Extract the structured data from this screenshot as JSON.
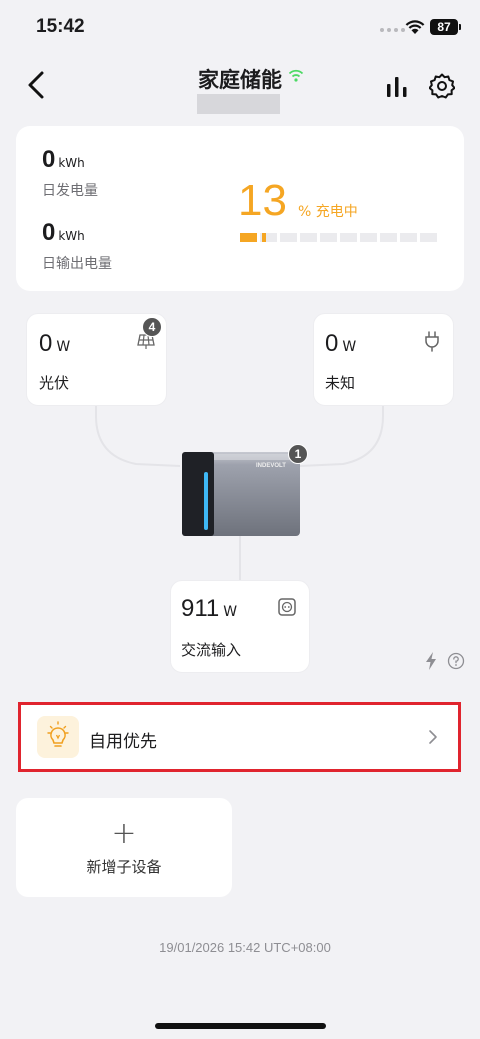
{
  "status": {
    "time": "15:42",
    "battery": "87"
  },
  "nav": {
    "title": "家庭储能"
  },
  "summary": {
    "daily_gen_value": "0",
    "daily_gen_unit": "kWh",
    "daily_gen_label": "日发电量",
    "daily_out_value": "0",
    "daily_out_unit": "kWh",
    "daily_out_label": "日输出电量",
    "soc_value": "13",
    "soc_unit": "%",
    "soc_status": "充电中",
    "soc_fraction": 0.13,
    "accent": "#f5a623"
  },
  "flow": {
    "pv": {
      "value": "0",
      "unit": "W",
      "label": "光伏",
      "badge": "4",
      "icon": "solar-panel-icon"
    },
    "unknown": {
      "value": "0",
      "unit": "W",
      "label": "未知",
      "icon": "plug-icon"
    },
    "battery": {
      "badge": "1",
      "brand": "INDEVOLT"
    },
    "ac": {
      "value": "911",
      "unit": "W",
      "label": "交流输入",
      "icon": "socket-icon"
    }
  },
  "mode": {
    "label": "自用优先",
    "icon": "lightbulb-icon",
    "highlight": "#e0242e"
  },
  "add_device": {
    "label": "新增子设备",
    "plus": "+"
  },
  "footer": {
    "timestamp": "19/01/2026 15:42  UTC+08:00"
  }
}
